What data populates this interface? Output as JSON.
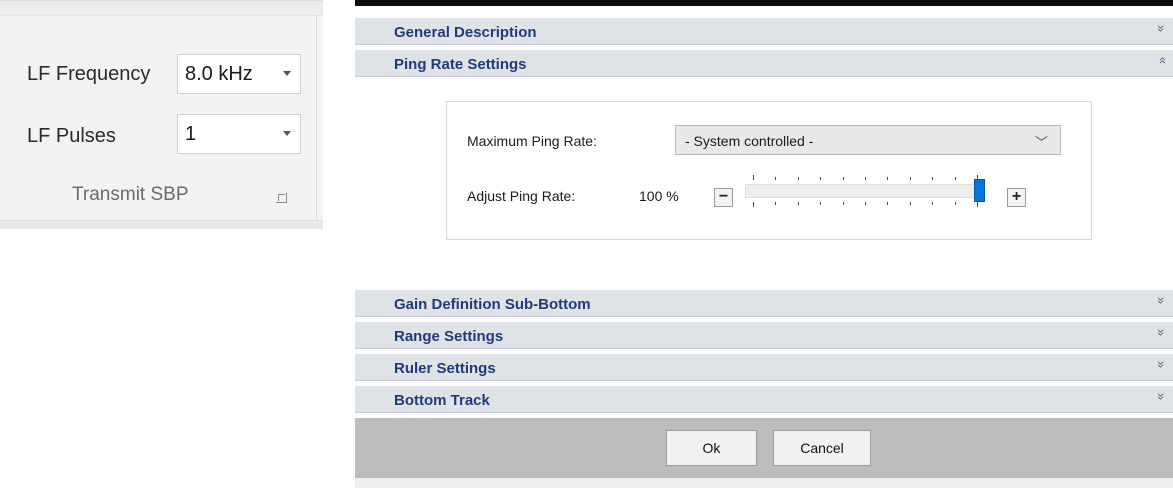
{
  "ribbon": {
    "lf_frequency_label": "LF Frequency",
    "lf_frequency_value": "8.0 kHz",
    "lf_pulses_label": "LF Pulses",
    "lf_pulses_value": "1",
    "group_label": "Transmit SBP"
  },
  "dialog": {
    "sections": {
      "general_description": "General Description",
      "ping_rate_settings": "Ping Rate Settings",
      "gain_definition": "Gain Definition Sub-Bottom",
      "range_settings": "Range Settings",
      "ruler_settings": "Ruler Settings",
      "bottom_track": "Bottom Track"
    },
    "expand_glyph": "≫",
    "ping_rate": {
      "max_label": "Maximum Ping Rate:",
      "max_value": "- System controlled -",
      "adjust_label": "Adjust Ping Rate:",
      "adjust_value": "100 %",
      "adjust_percent": 100,
      "minus": "−",
      "plus": "+"
    },
    "buttons": {
      "ok": "Ok",
      "cancel": "Cancel"
    }
  },
  "colors": {
    "section_header_text": "#1f3c7a",
    "section_header_bg": "#dfe3e8",
    "slider_thumb": "#0a74d9",
    "button_bar": "#bcbcbc"
  }
}
